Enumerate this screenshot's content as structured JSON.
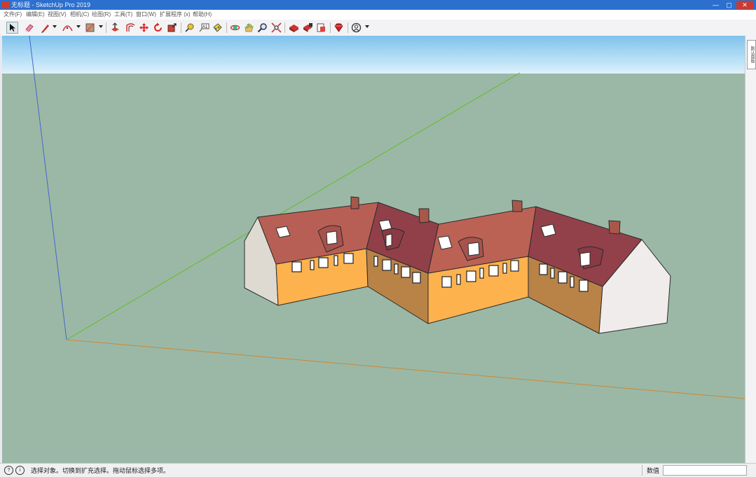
{
  "window": {
    "title": "无标题 - SketchUp Pro 2019",
    "buttons": [
      "minimize",
      "maximize",
      "close"
    ]
  },
  "menu": [
    "文件(F)",
    "编辑(E)",
    "视图(V)",
    "相机(C)",
    "绘图(R)",
    "工具(T)",
    "窗口(W)",
    "扩展程序 (x)",
    "帮助(H)"
  ],
  "toolbar": {
    "tools": [
      {
        "name": "select-tool",
        "icon": "cursor-arrow"
      },
      {
        "name": "eraser-tool",
        "icon": "eraser"
      },
      {
        "name": "line-tool",
        "icon": "pencil"
      },
      {
        "name": "arc-tool",
        "icon": "arc"
      },
      {
        "name": "shape-tool",
        "icon": "rectangle"
      },
      {
        "name": "push-pull-tool",
        "icon": "push-pull"
      },
      {
        "name": "offset-tool",
        "icon": "offset"
      },
      {
        "name": "move-tool",
        "icon": "move-cross"
      },
      {
        "name": "rotate-tool",
        "icon": "rotate"
      },
      {
        "name": "scale-tool",
        "icon": "scale"
      },
      {
        "name": "tape-measure-tool",
        "icon": "tape"
      },
      {
        "name": "text-tool",
        "icon": "text-a1"
      },
      {
        "name": "paint-bucket-tool",
        "icon": "paint-bucket"
      },
      {
        "name": "orbit-tool",
        "icon": "orbit"
      },
      {
        "name": "pan-tool",
        "icon": "hand"
      },
      {
        "name": "zoom-tool",
        "icon": "magnifier"
      },
      {
        "name": "zoom-extents-tool",
        "icon": "zoom-extents"
      },
      {
        "name": "3d-warehouse-tool",
        "icon": "warehouse"
      },
      {
        "name": "extension-warehouse-tool",
        "icon": "extension"
      },
      {
        "name": "send-to-layout-tool",
        "icon": "layout"
      },
      {
        "name": "ruby-tool",
        "icon": "ruby"
      },
      {
        "name": "account-tool",
        "icon": "user-circle"
      }
    ]
  },
  "sidepanel": {
    "tab_label": "默认面板"
  },
  "status": {
    "message": "选择对象。切换到扩充选择。拖动鼠标选择多项。",
    "measurement_label": "数值",
    "measurement_value": ""
  },
  "colors": {
    "sky_top": "#7ec2ec",
    "ground": "#9bb8a6",
    "wall_light": "#fdb24e",
    "wall_shaded": "#b88248",
    "roof": "#b85d55",
    "roof_dark": "#8f3e48",
    "gable_white": "#eeeaea",
    "axis_red": "#cc8833",
    "axis_green": "#66bb22",
    "axis_blue": "#4466cc"
  }
}
